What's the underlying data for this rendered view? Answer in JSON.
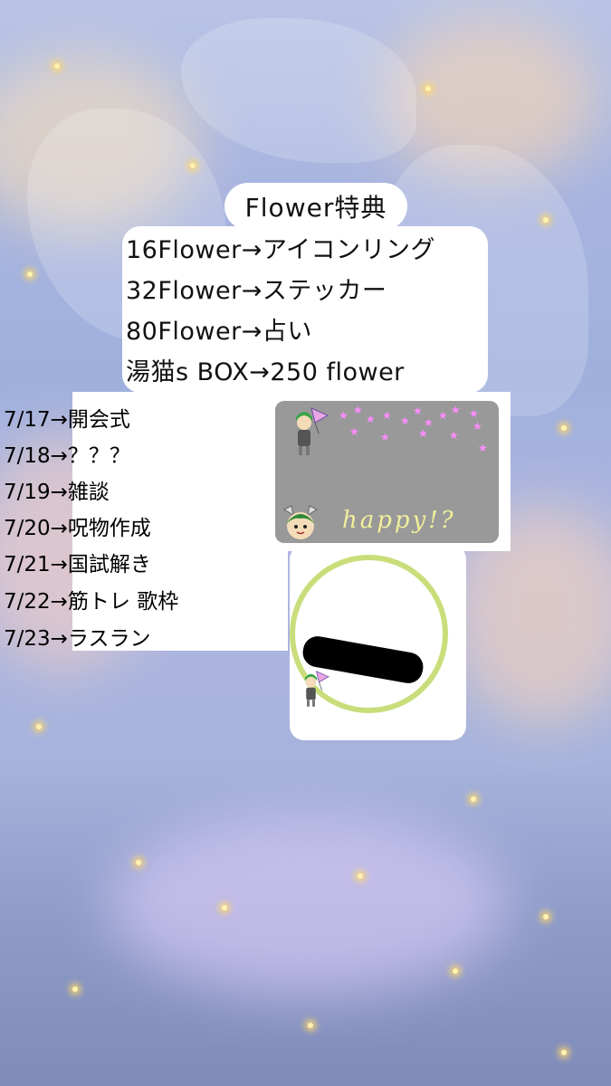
{
  "title": "Flower特典",
  "benefits": [
    "16Flower→アイコンリング",
    "32Flower→ステッカー",
    "80Flower→占い",
    "湯猫s BOX→250 flower"
  ],
  "schedule": [
    "7/17→開会式",
    "7/18→？？？",
    "7/19→雑談",
    "7/20→呪物作成",
    "7/21→国試解き",
    "7/22→筋トレ 歌枠",
    "7/23→ラスラン"
  ],
  "sticker_text": "happy!?",
  "colors": {
    "card": "#ffffff",
    "sticker_panel": "#999999",
    "stars": "#ff8cff",
    "happy_text": "#f2ef9c",
    "ring": "#c9de7a"
  }
}
